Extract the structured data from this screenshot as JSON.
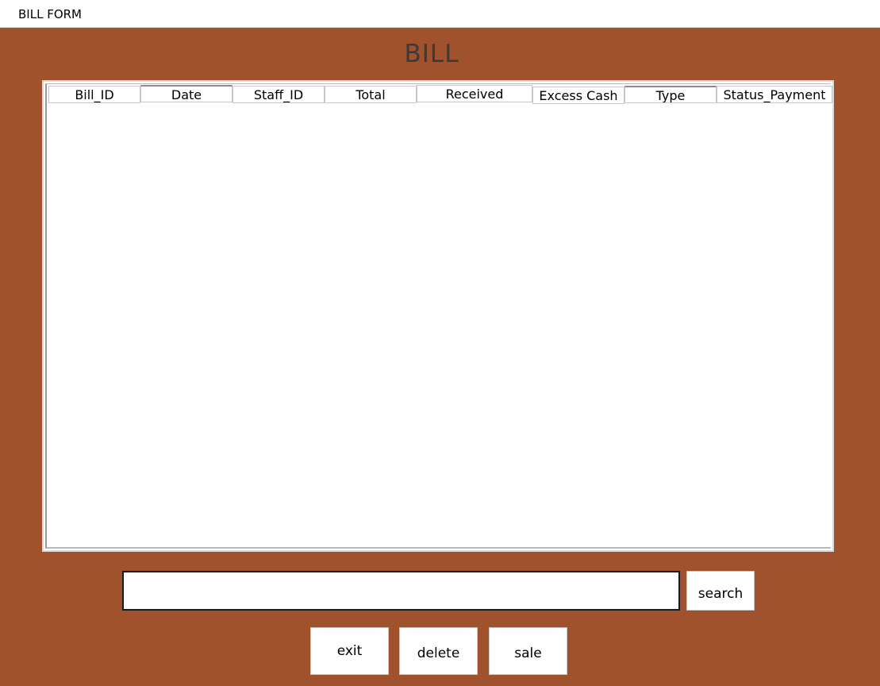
{
  "window": {
    "title": "BILL FORM"
  },
  "form": {
    "heading": "BILL"
  },
  "table": {
    "columns": [
      "Bill_ID",
      "Date",
      "Staff_ID",
      "Total",
      "Received",
      "Excess Cash",
      "Type",
      "Status_Payment"
    ],
    "rows": []
  },
  "search": {
    "value": "",
    "button_label": "search"
  },
  "actions": {
    "exit_label": "exit",
    "delete_label": "delete",
    "sale_label": "sale"
  },
  "colors": {
    "background": "#A0522D",
    "panel": "#FFFFFF"
  }
}
